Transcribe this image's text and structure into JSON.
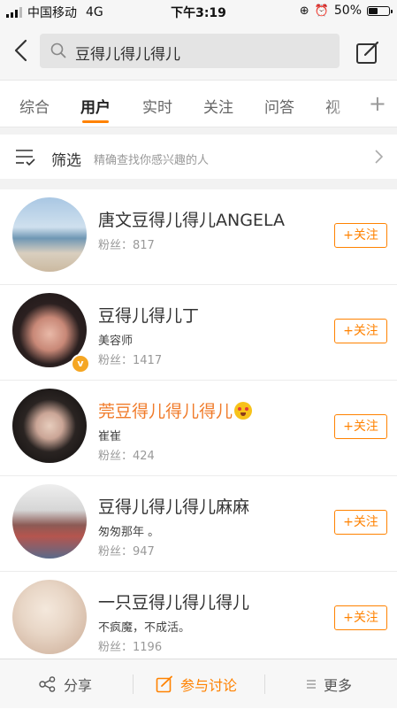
{
  "status_bar": {
    "carrier": "中国移动",
    "network": "4G",
    "time": "下午3:19",
    "battery": "50%",
    "battery_level": 0.5
  },
  "search": {
    "query": "豆得儿得儿得儿",
    "icon": "search-icon"
  },
  "tabs": {
    "items": [
      "综合",
      "用户",
      "实时",
      "关注",
      "问答",
      "视"
    ],
    "active": "用户",
    "accent": "#ff8200"
  },
  "filter": {
    "label": "筛选",
    "description": "精确查找你感兴趣的人"
  },
  "users": [
    {
      "name": "唐文豆得儿得儿ANGELA",
      "desc": "",
      "fans": "粉丝：817",
      "follow": "+关注",
      "verified": false,
      "highlight": false
    },
    {
      "name": "豆得儿得儿丁",
      "desc": "美容师",
      "fans": "粉丝：1417",
      "follow": "+关注",
      "verified": true,
      "highlight": false
    },
    {
      "name": "莞豆得儿得儿得儿",
      "desc": "崔崔",
      "fans": "粉丝：424",
      "follow": "+关注",
      "verified": false,
      "highlight": true
    },
    {
      "name": "豆得儿得儿得儿麻麻",
      "desc": "匆匆那年 。",
      "fans": "粉丝：947",
      "follow": "+关注",
      "verified": false,
      "highlight": false
    },
    {
      "name": "一只豆得儿得儿得儿",
      "desc": "不疯魔，不成活。",
      "fans": "粉丝：1196",
      "follow": "+关注",
      "verified": false,
      "highlight": false
    }
  ],
  "bottom_bar": {
    "share": "分享",
    "discuss": "参与讨论",
    "more": "更多"
  },
  "colors": {
    "accent": "#ff8200",
    "highlight_name": "#f07b2a",
    "verified_badge": "#f5a623"
  }
}
